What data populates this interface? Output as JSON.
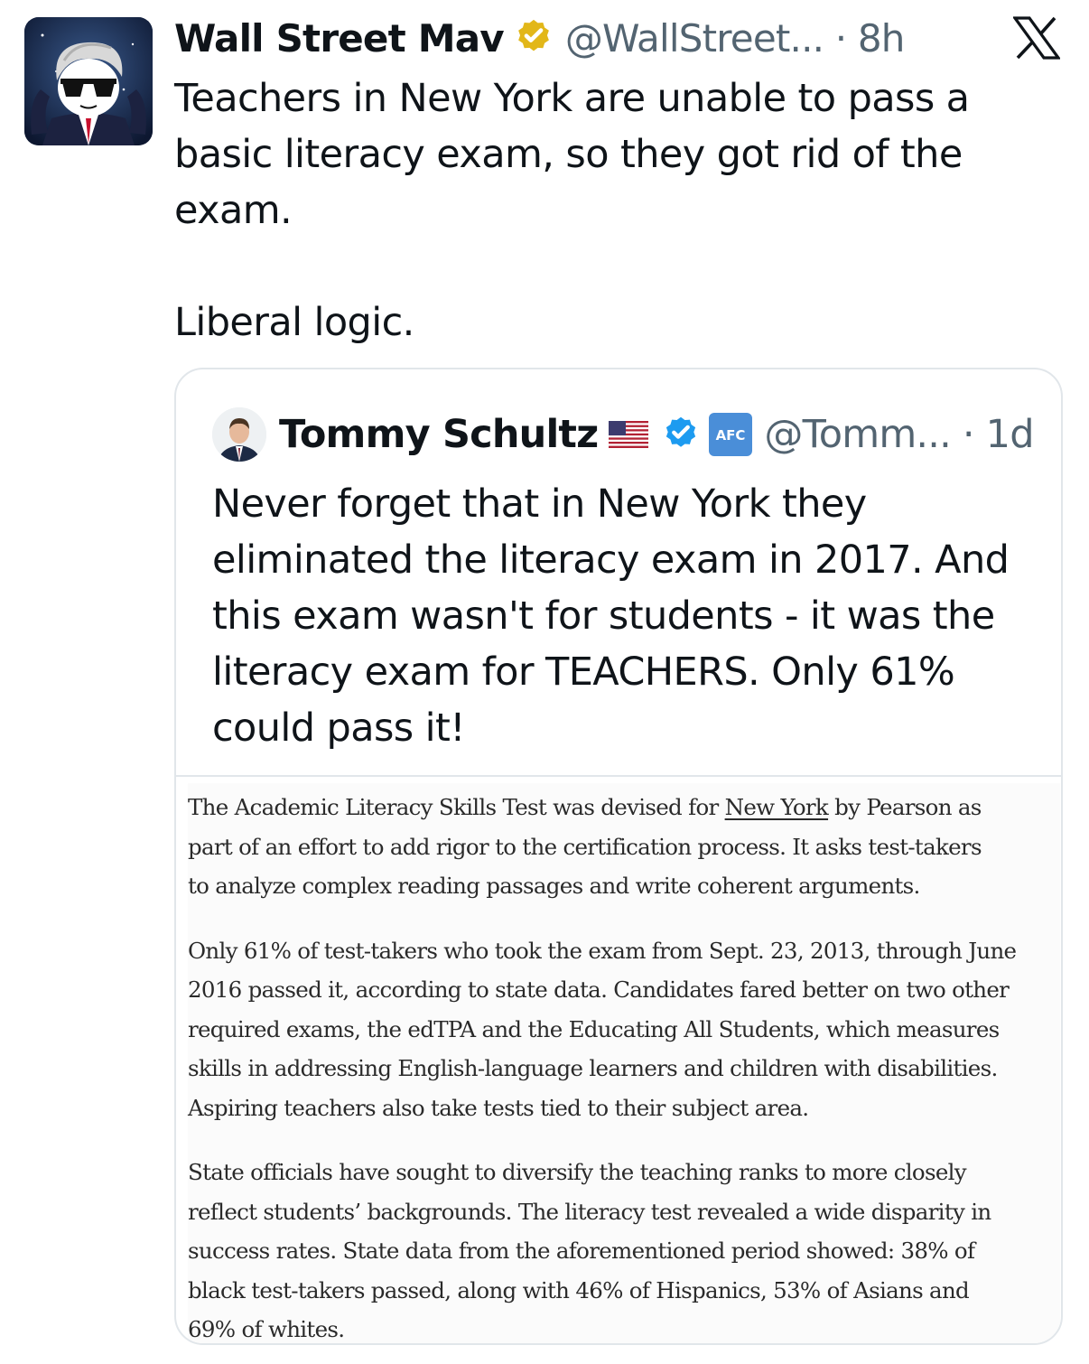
{
  "tweet": {
    "author_name": "Wall Street Mav",
    "handle_time": "@WallStreet... · 8h",
    "text_lines": [
      "Teachers in New York are unable to pass a",
      "basic literacy exam, so they got rid of the",
      "exam."
    ],
    "text_line_2": "Liberal logic."
  },
  "quote": {
    "author_name": "Tommy Schultz",
    "handle_time": "@Tomm... · 1d",
    "text_lines": [
      "Never forget that in New York they",
      "eliminated the literacy exam in 2017. And",
      "this exam wasn't for students - it was the",
      "literacy exam for TEACHERS. Only 61%",
      "could pass it!"
    ]
  },
  "article": {
    "para1": {
      "line1_before": "The Academic Literacy Skills Test was devised for ",
      "line1_link": "New York",
      "line1_after": " by Pearson as",
      "line2": "part of an effort to add rigor to the certification process. It asks test-takers",
      "line3": "to analyze complex reading passages and write coherent arguments."
    },
    "para2_lines": [
      "Only 61% of test-takers who took the exam from Sept. 23, 2013, through June",
      "2016 passed it, according to state data. Candidates fared better on two other",
      "required exams, the edTPA and the Educating All Students, which measures",
      "skills in addressing English-language learners and children with disabilities.",
      "Aspiring teachers also take tests tied to their subject area."
    ],
    "para3_lines": [
      "State officials have sought to diversify the teaching ranks to more closely",
      "reflect students’ backgrounds. The literacy test revealed a wide disparity in",
      "success rates. State data from the aforementioned period showed: 38% of",
      "black test-takers passed, along with 46% of Hispanics, 53% of Asians and",
      "69% of whites."
    ]
  },
  "colors": {
    "text_primary": "#0f1419",
    "text_secondary": "#536471",
    "gold_verified": "#e2b719",
    "blue_verified": "#1d9bf0",
    "border": "#e1e6ea"
  },
  "icons": {
    "platform_logo": "x-logo-icon",
    "author_verified": "gold-verified-badge-icon",
    "quote_verified": "blue-verified-badge-icon",
    "quote_flag": "us-flag-icon",
    "quote_affiliate": "afc-affiliate-badge-icon"
  }
}
